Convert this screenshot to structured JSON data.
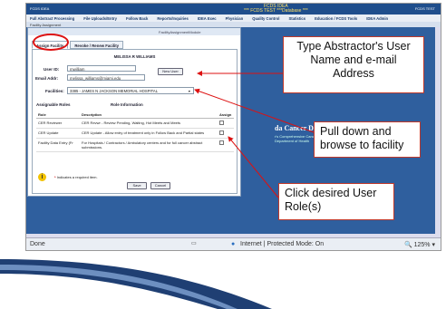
{
  "window": {
    "app_left": "FCDS IDEA",
    "title_center_1": "FCDS IDEA",
    "title_center_2": "*** FCDS TEST ***Database ***",
    "app_right": "FCDS TEST"
  },
  "menu": [
    "Full Abstract Processing",
    "File Uploads/Entry",
    "Follow Back",
    "Reports/Inquiries",
    "IDEA Exec",
    "Physician",
    "Quality Control",
    "Statistics",
    "Education / FCDS Tools",
    "IDEA Admin"
  ],
  "subbar": {
    "label": "Facility Assignment"
  },
  "dialog": {
    "header_title": "FacilityAssignmentModule",
    "tabs": [
      "Assign Facility",
      "Revoke / Renew Facility"
    ],
    "user_fullname": "MELISSA R WILLIAMS",
    "user_id_label": "User ID:",
    "user_id_value": "mwilliam",
    "email_label": "Email Addr:",
    "email_value": "melissa_williams@miami.edu",
    "new_user_button": "New User",
    "facilities_label": "Facilities:",
    "facility_selected": "3385 - JAMES N JACKSON MEMORIAL HOSPITAL",
    "assignable_roles": "Assignable Roles",
    "role_information": "Role Information",
    "columns": [
      "Role",
      "Description",
      "Assign"
    ],
    "roles": [
      {
        "role": "CER Reviewer",
        "description": "CER Revwr - Review Pending, Waiting, Hot Meets and Meets"
      },
      {
        "role": "CER Update",
        "description": "CER Update - Allow entry of treatment only in Follow Back and Partial states"
      },
      {
        "role": "Facility Data Entry (Fr",
        "description": "For Hospitals / Contractors / Ambulatory centers and for full cancer abstract submissions."
      }
    ],
    "info_icon": "i",
    "required_note": "Indicates a required item.",
    "save": "Save",
    "cancel": "Cancel"
  },
  "background_page": {
    "system_name": "da Cancer Data System",
    "sub1": "r's Comprehensive Cancer Center",
    "sub2": "Department of Health"
  },
  "statusbar": {
    "left": "Done",
    "zone": "Internet | Protected Mode: On",
    "zoom": "125%"
  },
  "callouts": {
    "type_name": "Type Abstractor's User Name and e-mail Address",
    "pull_down": "Pull down and browse to facility",
    "click_role": "Click desired User Role(s)"
  },
  "colors": {
    "callout_border": "#c0392b",
    "swoosh": "#1f3f73",
    "screen_bg": "#2f5f9e"
  }
}
